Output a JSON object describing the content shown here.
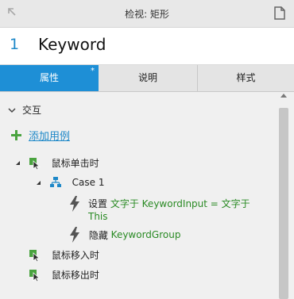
{
  "titlebar": {
    "title": "检视: 矩形"
  },
  "header": {
    "number": "1",
    "name": "Keyword"
  },
  "tabs": [
    {
      "label": "属性",
      "marker": "*"
    },
    {
      "label": "说明"
    },
    {
      "label": "样式"
    }
  ],
  "section": {
    "label": "交互"
  },
  "add_case": {
    "label": "添加用例"
  },
  "events": {
    "click": "鼠标单击时",
    "mouse_enter": "鼠标移入时",
    "mouse_leave": "鼠标移出时"
  },
  "case": {
    "label": "Case 1"
  },
  "actions": [
    {
      "verb": "设置",
      "detail_line1": "文字于 KeywordInput = 文字于",
      "detail_line2": "This"
    },
    {
      "verb": "隐藏",
      "detail_line1": "KeywordGroup"
    }
  ],
  "colors": {
    "accent": "#1e8fd6",
    "action_text": "#2a8a24",
    "event_icon": "#4aa33f"
  }
}
